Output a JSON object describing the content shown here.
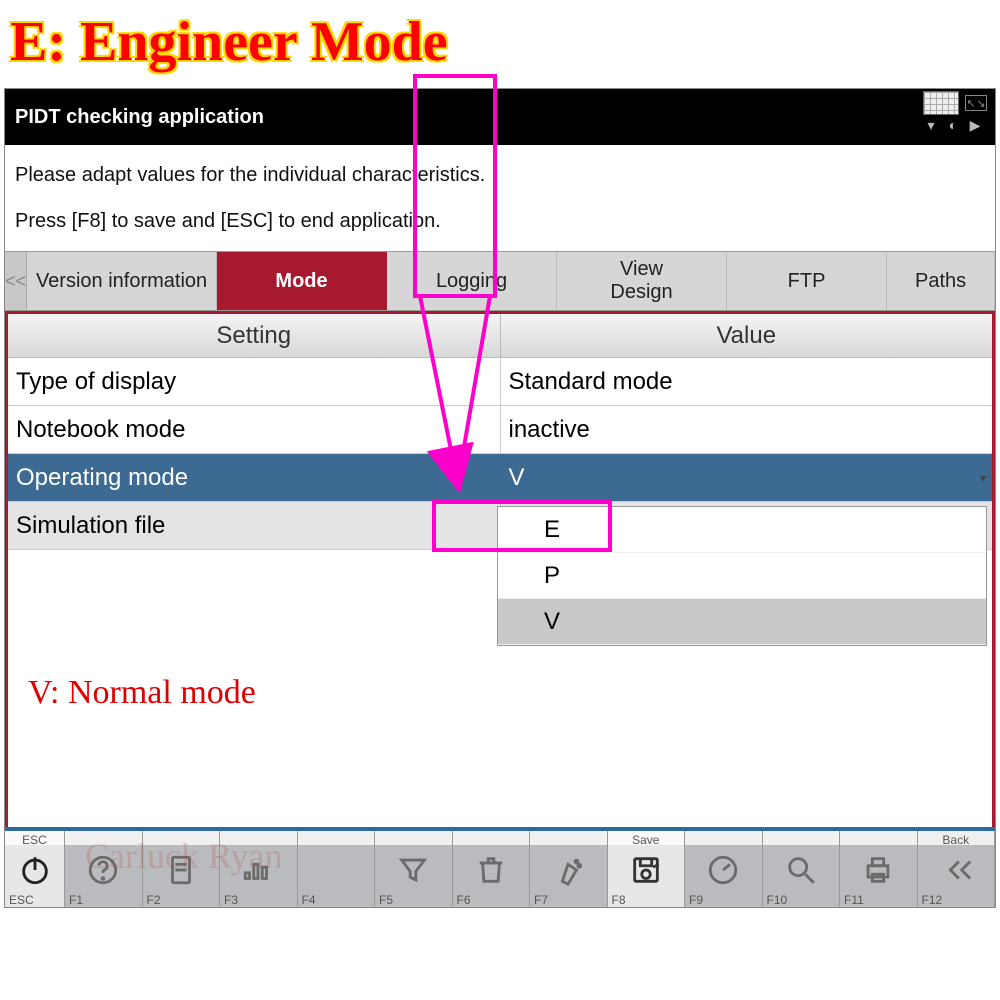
{
  "annotations": {
    "top": "E:    Engineer Mode",
    "v_mode": "V: Normal  mode"
  },
  "topbar": {
    "title": "PIDT checking application"
  },
  "instructions": {
    "line1": "Please adapt values for the individual characteristics.",
    "line2": "Press [F8] to save and [ESC] to end application."
  },
  "tabs": {
    "prev": "<<",
    "items": [
      "Version information",
      "Mode",
      "Logging",
      "View\nDesign",
      "FTP",
      "Paths"
    ],
    "active": "Mode"
  },
  "table": {
    "headers": {
      "setting": "Setting",
      "value": "Value"
    },
    "rows": [
      {
        "setting": "Type of display",
        "value": "Standard mode"
      },
      {
        "setting": "Notebook mode",
        "value": "inactive"
      },
      {
        "setting": "Operating mode",
        "value": "V",
        "selected": true
      },
      {
        "setting": "Simulation file",
        "value": ""
      }
    ],
    "dropdown": {
      "options": [
        "E",
        "P",
        "V"
      ],
      "selected": "V"
    }
  },
  "fkeys": {
    "esc_top": "ESC",
    "esc_bottom": "ESC",
    "save_top": "Save",
    "back_top": "Back",
    "labels": [
      "F1",
      "F2",
      "F3",
      "F4",
      "F5",
      "F6",
      "F7",
      "F8",
      "F9",
      "F10",
      "F11",
      "F12"
    ]
  },
  "watermark": "Carluck Ryan"
}
